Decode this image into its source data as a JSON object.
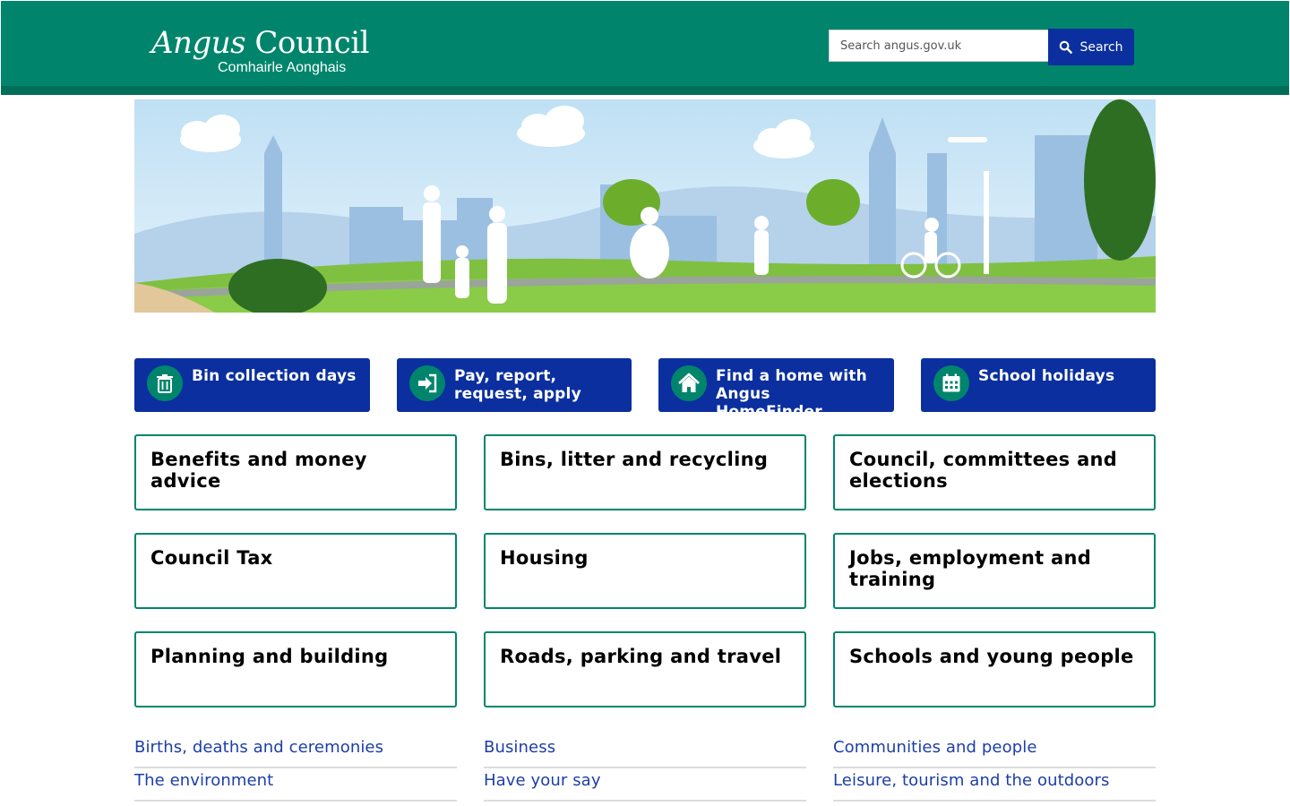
{
  "header": {
    "logo": {
      "main_prefix": "Angus",
      "main_suffix": "Council",
      "sub": "Comhairle Aonghais"
    },
    "search": {
      "placeholder": "Search angus.gov.uk",
      "value": "",
      "button_label": "Search"
    },
    "colors": {
      "bar": "#00856c",
      "button": "#0b2f9f"
    }
  },
  "quick_links": [
    {
      "label": "Bin collection days",
      "icon": "bin-icon"
    },
    {
      "label": "Pay, report, request, apply",
      "icon": "arrow-in-icon"
    },
    {
      "label": "Find a home with Angus HomeFinder",
      "icon": "house-icon"
    },
    {
      "label": "School holidays",
      "icon": "calendar-icon"
    }
  ],
  "topics": [
    "Benefits and money advice",
    "Bins, litter and recycling",
    "Council, committees and elections",
    "Council Tax",
    "Housing",
    "Jobs, employment and training",
    "Planning and building",
    "Roads, parking and travel",
    "Schools and young people"
  ],
  "more_links": [
    "Births, deaths and ceremonies",
    "Business",
    "Communities and people",
    "The environment",
    "Have your say",
    "Leisure, tourism and the outdoors"
  ],
  "colors": {
    "accent": "#00856c",
    "link": "#1c3ea8",
    "button": "#0b2f9f"
  }
}
